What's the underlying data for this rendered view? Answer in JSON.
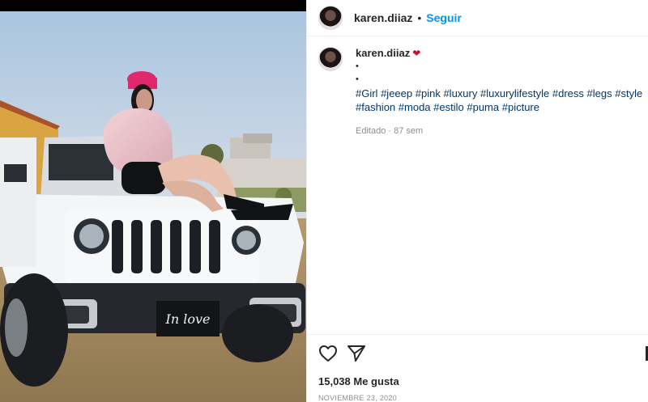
{
  "post": {
    "username": "karen.diiaz",
    "follow_label": "Seguir",
    "separator": "•",
    "caption": {
      "username": "karen.diiaz",
      "emoji": "❤",
      "bullets": [
        "•",
        "•"
      ],
      "hashtags": [
        "#Girl",
        "#jeeep",
        "#pink",
        "#luxury",
        "#luxurylifestyle",
        "#dress",
        "#legs",
        "#style",
        "#fashion",
        "#moda",
        "#estilo",
        "#puma",
        "#picture"
      ],
      "edited": "Editado",
      "age": "87 sem"
    },
    "likes_count": "15,038",
    "likes_label": "Me gusta",
    "date": "NOVIEMBRE 23, 2020",
    "plate_text": "In love"
  },
  "icons": {
    "like": "heart-outline-icon",
    "share": "paper-plane-icon",
    "save": "bookmark-icon"
  }
}
